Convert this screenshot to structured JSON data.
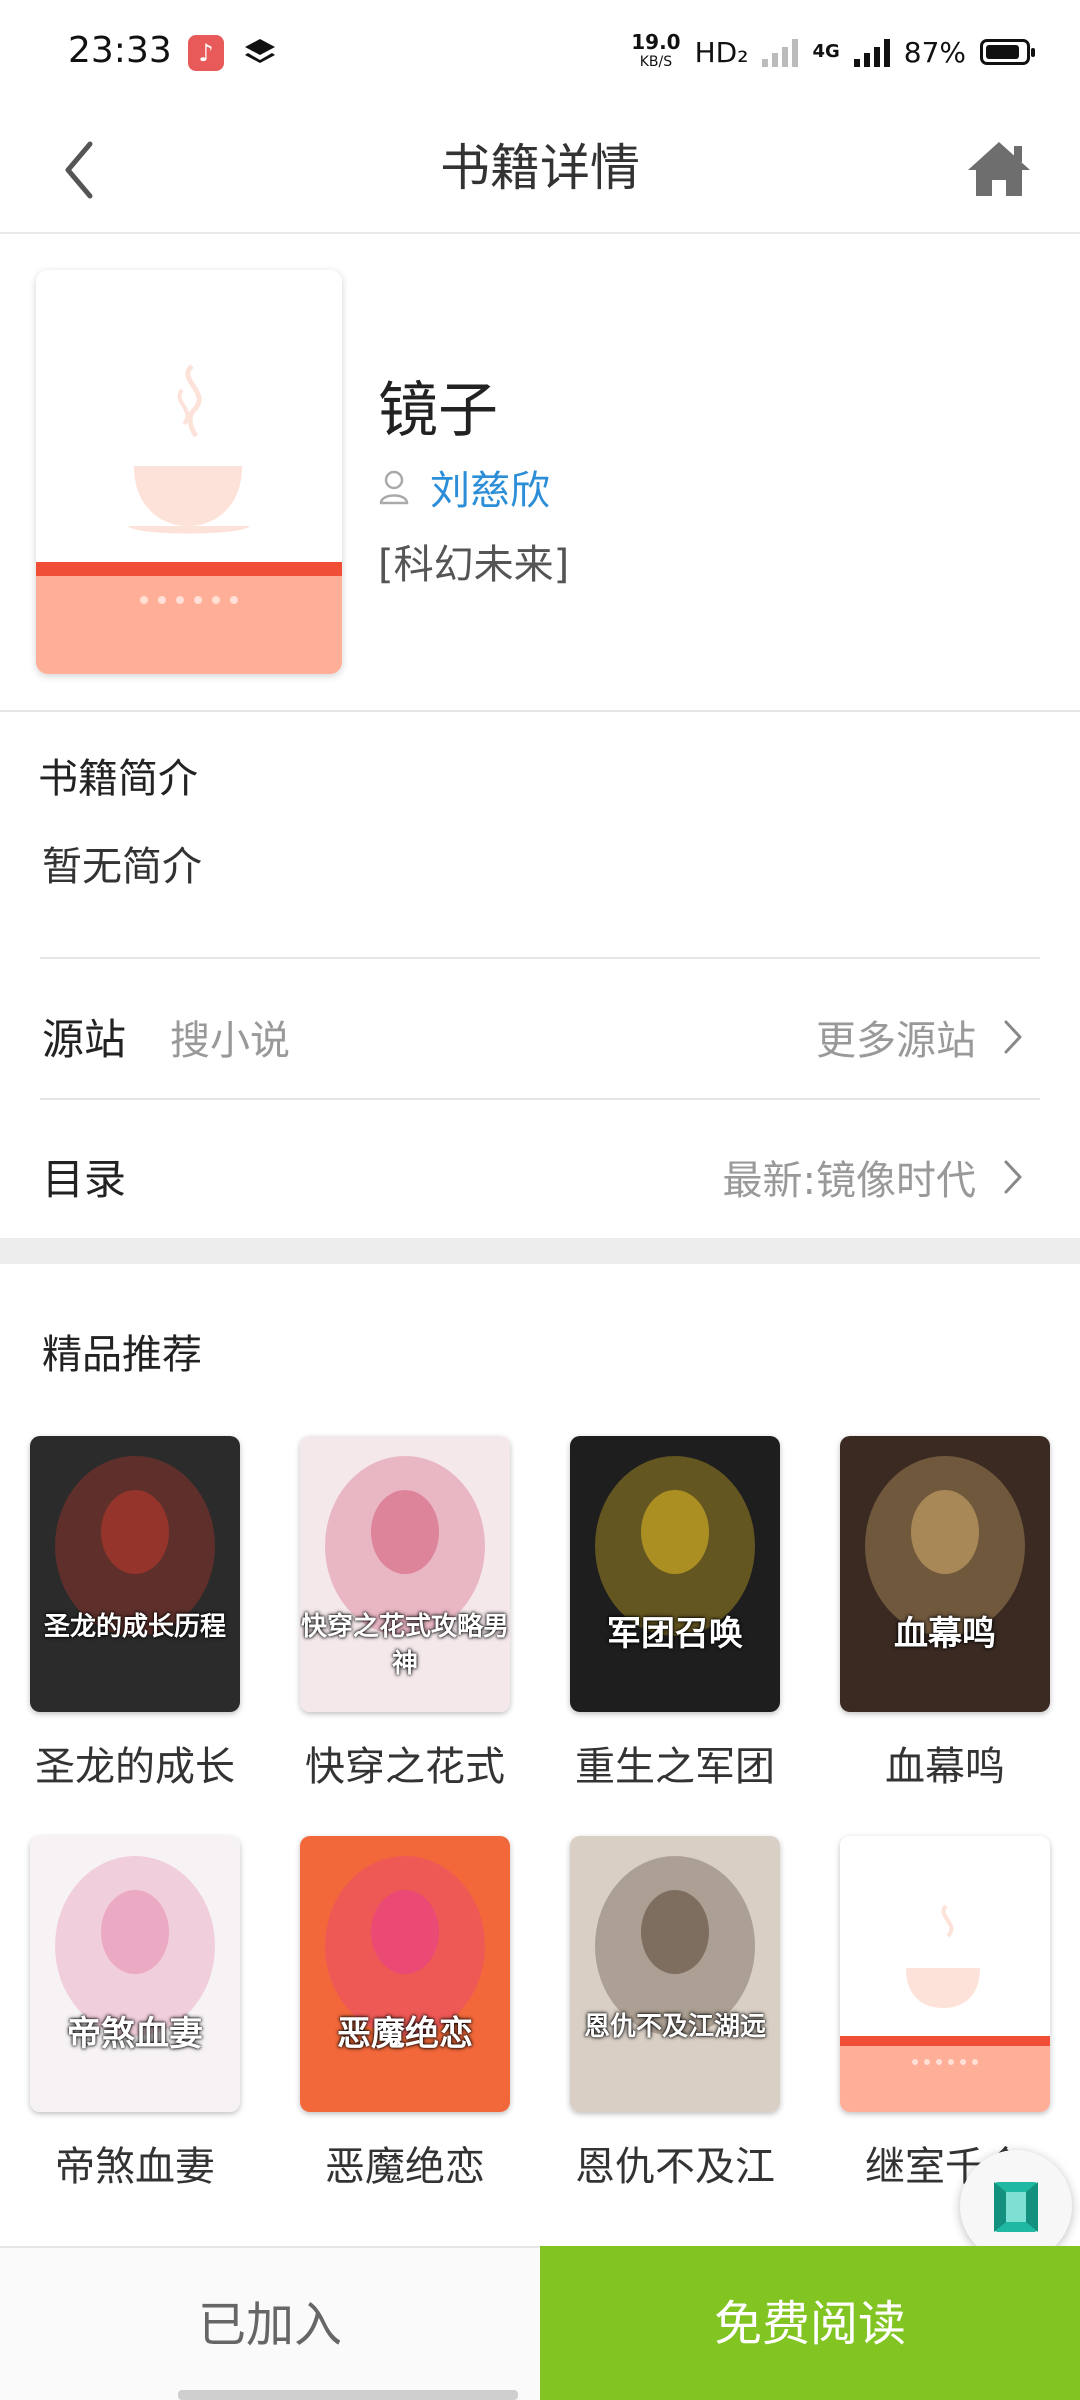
{
  "status_bar": {
    "time": "23:33",
    "net_speed": "19.0",
    "net_unit": "KB/S",
    "hd": "HD₂",
    "network": "4G",
    "battery": "87%",
    "battery_level": 0.87
  },
  "header": {
    "title": "书籍详情",
    "back_icon": "chevron-left-icon",
    "home_icon": "home-icon"
  },
  "book": {
    "title": "镜子",
    "author": "刘慈欣",
    "category": "[科幻未来]",
    "cover_colors": {
      "band": "#f04e37",
      "lower": "#ffae98",
      "cup": "#fde2da"
    }
  },
  "intro": {
    "heading": "书籍简介",
    "text": "暂无简介"
  },
  "source_row": {
    "label": "源站",
    "value": "搜小说",
    "more": "更多源站"
  },
  "catalog_row": {
    "label": "目录",
    "latest": "最新:镜像时代"
  },
  "recommend": {
    "heading": "精品推荐",
    "books": [
      {
        "name": "圣龙的成长",
        "cover_text": "圣龙的成长历程",
        "bg": "#2b2b2b",
        "accent": "#c0392b"
      },
      {
        "name": "快穿之花式",
        "cover_text": "快穿之花式攻略男神",
        "bg": "#f4e8ea",
        "accent": "#d35b7a"
      },
      {
        "name": "重生之军团",
        "cover_text": "军团召唤",
        "bg": "#1e1e1e",
        "accent": "#e8c026"
      },
      {
        "name": "血幕鸣",
        "cover_text": "血幕鸣",
        "bg": "#3a2a22",
        "accent": "#d8b070"
      },
      {
        "name": "帝煞血妻",
        "cover_text": "帝煞血妻",
        "bg": "#f7f3f5",
        "accent": "#e58ab0"
      },
      {
        "name": "恶魔绝恋",
        "cover_text": "恶魔绝恋",
        "bg": "#f2683a",
        "accent": "#e83e8c"
      },
      {
        "name": "恩仇不及江",
        "cover_text": "恩仇不及江湖远",
        "bg": "#d9cfc5",
        "accent": "#5a4636"
      },
      {
        "name": "继室千金",
        "cover_text": "",
        "bg": "#ffffff",
        "accent": "#f04e37"
      }
    ]
  },
  "bottom": {
    "added": "已加入",
    "read": "免费阅读"
  }
}
